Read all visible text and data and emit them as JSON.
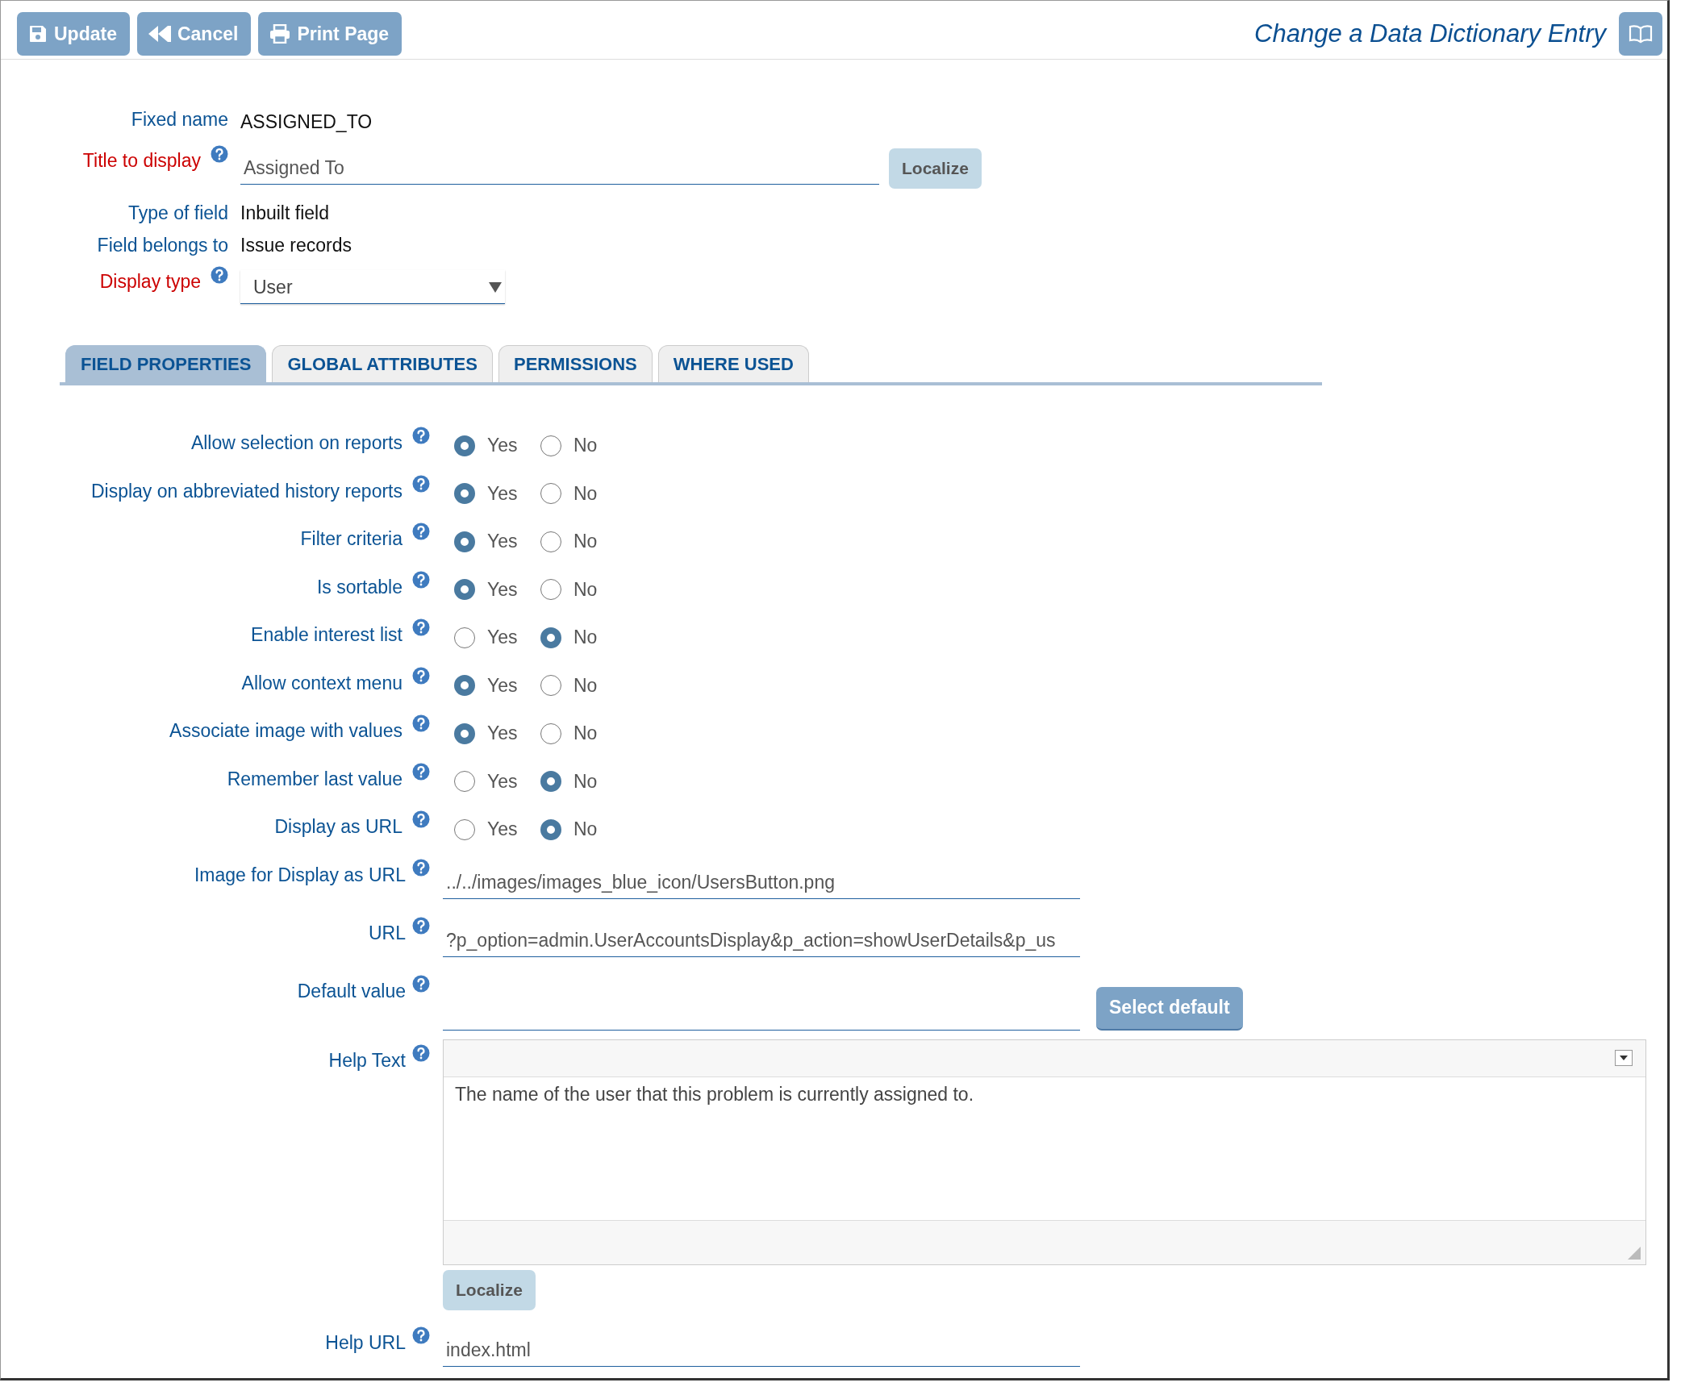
{
  "toolbar": {
    "update": "Update",
    "cancel": "Cancel",
    "print": "Print Page"
  },
  "page_title": "Change a Data Dictionary Entry",
  "header_fields": [
    {
      "label": "Fixed name",
      "kind": "text",
      "value": "ASSIGNED_TO",
      "required": false,
      "help": false
    },
    {
      "label": "Title to display",
      "kind": "input",
      "value": "Assigned To",
      "required": true,
      "help": true,
      "button": "Localize"
    },
    {
      "label": "Type of field",
      "kind": "text",
      "value": "Inbuilt field",
      "required": false,
      "help": false
    },
    {
      "label": "Field belongs to",
      "kind": "text",
      "value": "Issue records",
      "required": false,
      "help": false
    },
    {
      "label": "Display type",
      "kind": "select",
      "value": "User",
      "required": true,
      "help": true
    }
  ],
  "tabs": [
    {
      "label": "FIELD PROPERTIES",
      "selected": true
    },
    {
      "label": "GLOBAL ATTRIBUTES",
      "selected": false
    },
    {
      "label": "PERMISSIONS",
      "selected": false
    },
    {
      "label": "WHERE USED",
      "selected": false
    }
  ],
  "properties": [
    {
      "label": "Allow selection on reports",
      "options": [
        {
          "label": "Yes",
          "selected": true
        },
        {
          "label": "No",
          "selected": false
        }
      ]
    },
    {
      "label": "Display on abbreviated history reports",
      "options": [
        {
          "label": "Yes",
          "selected": true
        },
        {
          "label": "No",
          "selected": false
        }
      ]
    },
    {
      "label": "Filter criteria",
      "options": [
        {
          "label": "Yes",
          "selected": true
        },
        {
          "label": "No",
          "selected": false
        }
      ]
    },
    {
      "label": "Is sortable",
      "options": [
        {
          "label": "Yes",
          "selected": true
        },
        {
          "label": "No",
          "selected": false
        }
      ]
    },
    {
      "label": "Enable interest list",
      "options": [
        {
          "label": "Yes",
          "selected": false
        },
        {
          "label": "No",
          "selected": true
        }
      ]
    },
    {
      "label": "Allow context menu",
      "options": [
        {
          "label": "Yes",
          "selected": true
        },
        {
          "label": "No",
          "selected": false
        }
      ]
    },
    {
      "label": "Associate image with values",
      "options": [
        {
          "label": "Yes",
          "selected": true
        },
        {
          "label": "No",
          "selected": false
        }
      ]
    },
    {
      "label": "Remember last value",
      "options": [
        {
          "label": "Yes",
          "selected": false
        },
        {
          "label": "No",
          "selected": true
        }
      ]
    },
    {
      "label": "Display as URL",
      "options": [
        {
          "label": "Yes",
          "selected": false
        },
        {
          "label": "No",
          "selected": true
        }
      ]
    }
  ],
  "fields": [
    {
      "label": "Image for Display as URL",
      "value": "../../images/images_blue_icon/UsersButton.png"
    },
    {
      "label": "URL",
      "value": "?p_option=admin.UserAccountsDisplay&p_action=showUserDetails&p_us"
    },
    {
      "label": "Default value",
      "button": "Select default"
    }
  ],
  "help_text": {
    "label": "Help Text",
    "value": "The name of the user that this problem is currently assigned to.",
    "button": "Localize"
  },
  "help_url": {
    "label": "Help URL",
    "value": "index.html"
  }
}
